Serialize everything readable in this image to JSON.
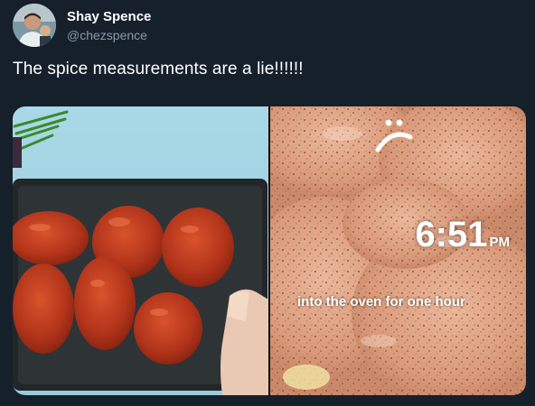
{
  "author": {
    "display_name": "Shay Spence",
    "handle": "@chezspence"
  },
  "tweet": {
    "text": "The spice measurements are a lie!!!!!!"
  },
  "media": {
    "overlay_time": "6:51",
    "overlay_ampm": "PM",
    "overlay_caption": "into the oven for one hour",
    "overlay_emoji": "sad-face-icon"
  },
  "colors": {
    "background": "#15202b",
    "name": "#ffffff",
    "handle": "#8899a6"
  }
}
